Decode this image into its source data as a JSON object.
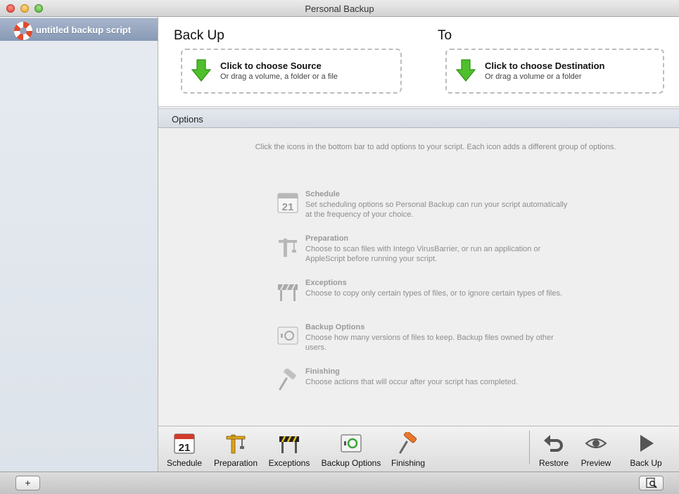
{
  "window": {
    "title": "Personal Backup"
  },
  "sidebar": {
    "items": [
      {
        "label": "untitled backup script",
        "icon": "lifebuoy-icon"
      }
    ]
  },
  "source": {
    "heading": "Back Up",
    "title": "Click to choose Source",
    "subtitle": "Or drag a volume, a folder or a file"
  },
  "destination": {
    "heading": "To",
    "title": "Click to choose Destination",
    "subtitle": "Or drag a volume or a folder"
  },
  "options": {
    "header": "Options",
    "hint": "Click the icons in the bottom bar to add options to your script. Each icon adds a different group of options.",
    "groups": [
      {
        "title": "Schedule",
        "desc": "Set scheduling options so Personal Backup can run your script automatically at the frequency of your choice.",
        "icon": "calendar-icon"
      },
      {
        "title": "Preparation",
        "desc": "Choose to scan files with Intego VirusBarrier, or run an application or AppleScript before running your script.",
        "icon": "crane-icon"
      },
      {
        "title": "Exceptions",
        "desc": "Choose to copy only certain types of files, or to ignore certain types of files.",
        "icon": "barrier-icon"
      },
      {
        "title": "Backup Options",
        "desc": "Choose how many versions of files to keep. Backup files owned by other users.",
        "icon": "disk-icon"
      },
      {
        "title": "Finishing",
        "desc": "Choose actions that will occur after your script has completed.",
        "icon": "paint-roller-icon"
      }
    ]
  },
  "toolbar": {
    "schedule": "Schedule",
    "preparation": "Preparation",
    "exceptions": "Exceptions",
    "backup_options": "Backup Options",
    "finishing": "Finishing",
    "restore": "Restore",
    "preview": "Preview",
    "back_up": "Back Up",
    "calendar_day": "21"
  },
  "statusbar": {
    "add_label": "+"
  },
  "colors": {
    "arrow_green": "#4fbf2c",
    "sidebar_selected": "#93a4be"
  }
}
